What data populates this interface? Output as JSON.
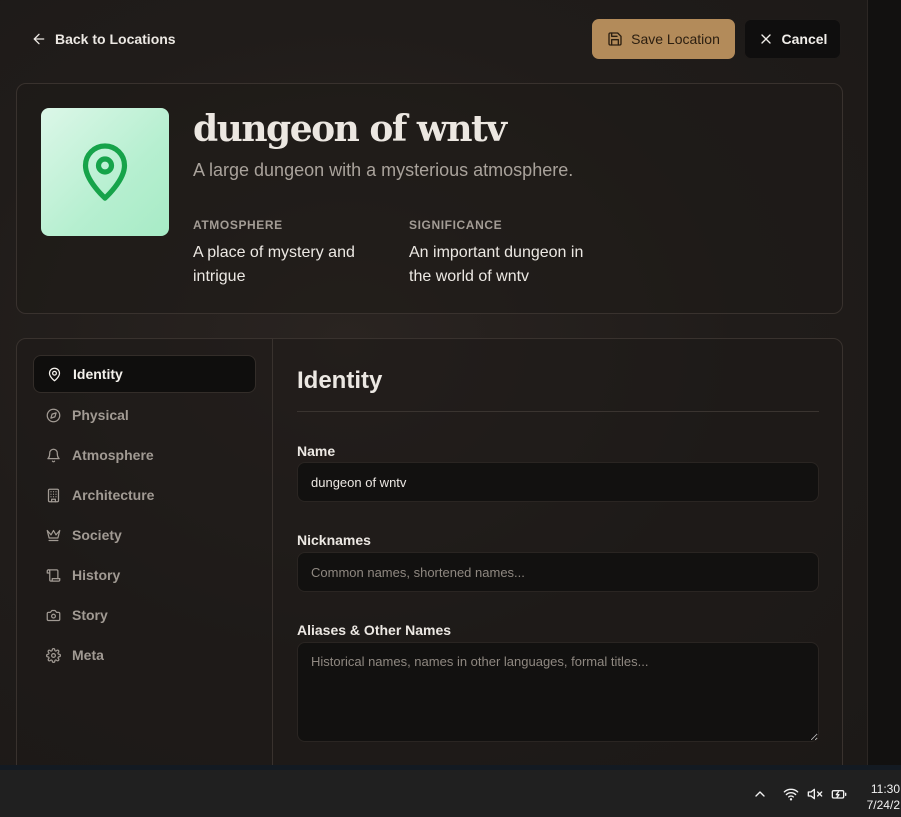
{
  "topbar": {
    "back_label": "Back to Locations",
    "save_label": "Save Location",
    "cancel_label": "Cancel"
  },
  "header": {
    "title": "dungeon of wntv",
    "description": "A large dungeon with a mysterious atmosphere.",
    "image_icon": "map-pin-icon",
    "meta": [
      {
        "label": "Atmosphere",
        "value": "A place of mystery and intrigue"
      },
      {
        "label": "Significance",
        "value": "An important dungeon in the world of wntv"
      }
    ]
  },
  "sidebar": {
    "items": [
      {
        "label": "Identity",
        "icon": "map-pin-icon",
        "active": true
      },
      {
        "label": "Physical",
        "icon": "compass-icon",
        "active": false
      },
      {
        "label": "Atmosphere",
        "icon": "bell-icon",
        "active": false
      },
      {
        "label": "Architecture",
        "icon": "building-icon",
        "active": false
      },
      {
        "label": "Society",
        "icon": "crown-icon",
        "active": false
      },
      {
        "label": "History",
        "icon": "scroll-icon",
        "active": false
      },
      {
        "label": "Story",
        "icon": "camera-icon",
        "active": false
      },
      {
        "label": "Meta",
        "icon": "gear-icon",
        "active": false
      }
    ]
  },
  "section": {
    "title": "Identity",
    "fields": {
      "name": {
        "label": "Name",
        "value": "dungeon of wntv"
      },
      "nicknames": {
        "label": "Nicknames",
        "placeholder": "Common names, shortened names..."
      },
      "aliases": {
        "label": "Aliases & Other Names",
        "placeholder": "Historical names, names in other languages, formal titles..."
      }
    }
  },
  "taskbar": {
    "time": "11:30",
    "date": "7/24/2"
  },
  "colors": {
    "accent": "#b38b5a",
    "icon_green": "#16a34a",
    "background": "#1f1b19"
  }
}
